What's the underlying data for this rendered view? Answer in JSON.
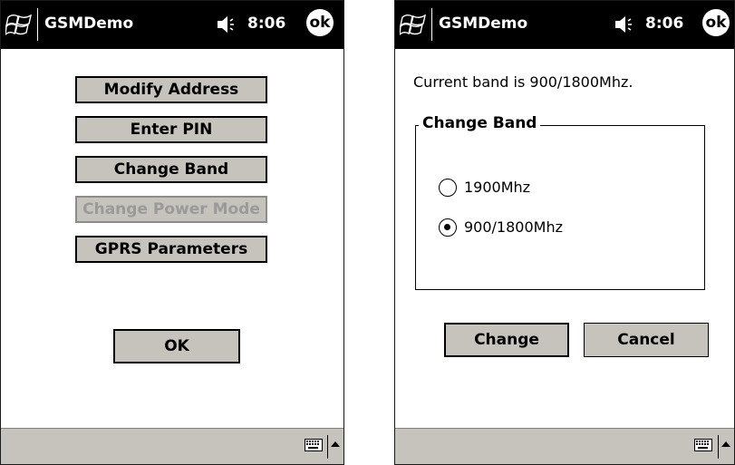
{
  "left_screen": {
    "title": "GSMDemo",
    "time": "8:06",
    "ok_badge": "ok",
    "menu_buttons": [
      {
        "label": "Modify Address",
        "enabled": true
      },
      {
        "label": "Enter PIN",
        "enabled": true
      },
      {
        "label": "Change Band",
        "enabled": true
      },
      {
        "label": "Change Power Mode",
        "enabled": false
      },
      {
        "label": "GPRS Parameters",
        "enabled": true
      }
    ],
    "ok_button_label": "OK"
  },
  "right_screen": {
    "title": "GSMDemo",
    "time": "8:06",
    "ok_badge": "ok",
    "status_text": "Current band is 900/1800Mhz.",
    "group_title": "Change Band",
    "options": [
      {
        "label": "1900Mhz",
        "selected": false
      },
      {
        "label": "900/1800Mhz",
        "selected": true
      }
    ],
    "change_button_label": "Change",
    "cancel_button_label": "Cancel"
  },
  "colors": {
    "title_bar": "#000000",
    "button_face": "#c6c3bd",
    "disabled_text": "#9a9a9a"
  },
  "icons": [
    "windows-flag-icon",
    "speaker-icon",
    "ok-icon",
    "keyboard-icon",
    "up-arrow-icon"
  ]
}
